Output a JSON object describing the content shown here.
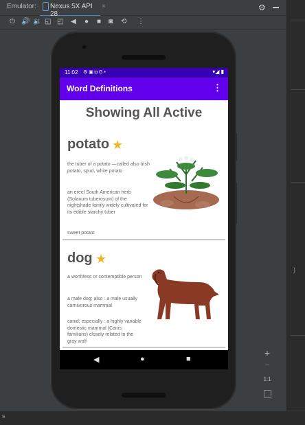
{
  "ide": {
    "emulator_label": "Emulator:",
    "device_tab": "Nexus 5X API 28",
    "tab_close": "×",
    "zoom_ratio": "1:1",
    "status_char": "s"
  },
  "device": {
    "status": {
      "time": "11:02",
      "icons": "⚙ ▣ ◘ G •",
      "right": "▾◢ ▮"
    },
    "app_title": "Word Definitions",
    "menu_icon": "⋮",
    "heading": "Showing All Active",
    "cards": [
      {
        "word": "potato",
        "definitions": [
          "the tuber of a potato —called also Irish potato, spud, white potato",
          "an erect South American herb (Solanum tuberosum) of the nightshade family widely cultivated for its edible starchy tuber"
        ],
        "synonym": "sweet potato",
        "image": "potato-plant-illustration"
      },
      {
        "word": "dog",
        "definitions": [
          "a worthless or contemptible person",
          "a male dog; also : a male usually carnivorous mammal",
          "canid; especially : a highly variable domestic mammal (Canis familiaris) closely related to the gray wolf"
        ],
        "image": "dog-anatomy-illustration"
      }
    ],
    "nav": {
      "back": "◀",
      "home": "●",
      "recents": "■"
    }
  }
}
